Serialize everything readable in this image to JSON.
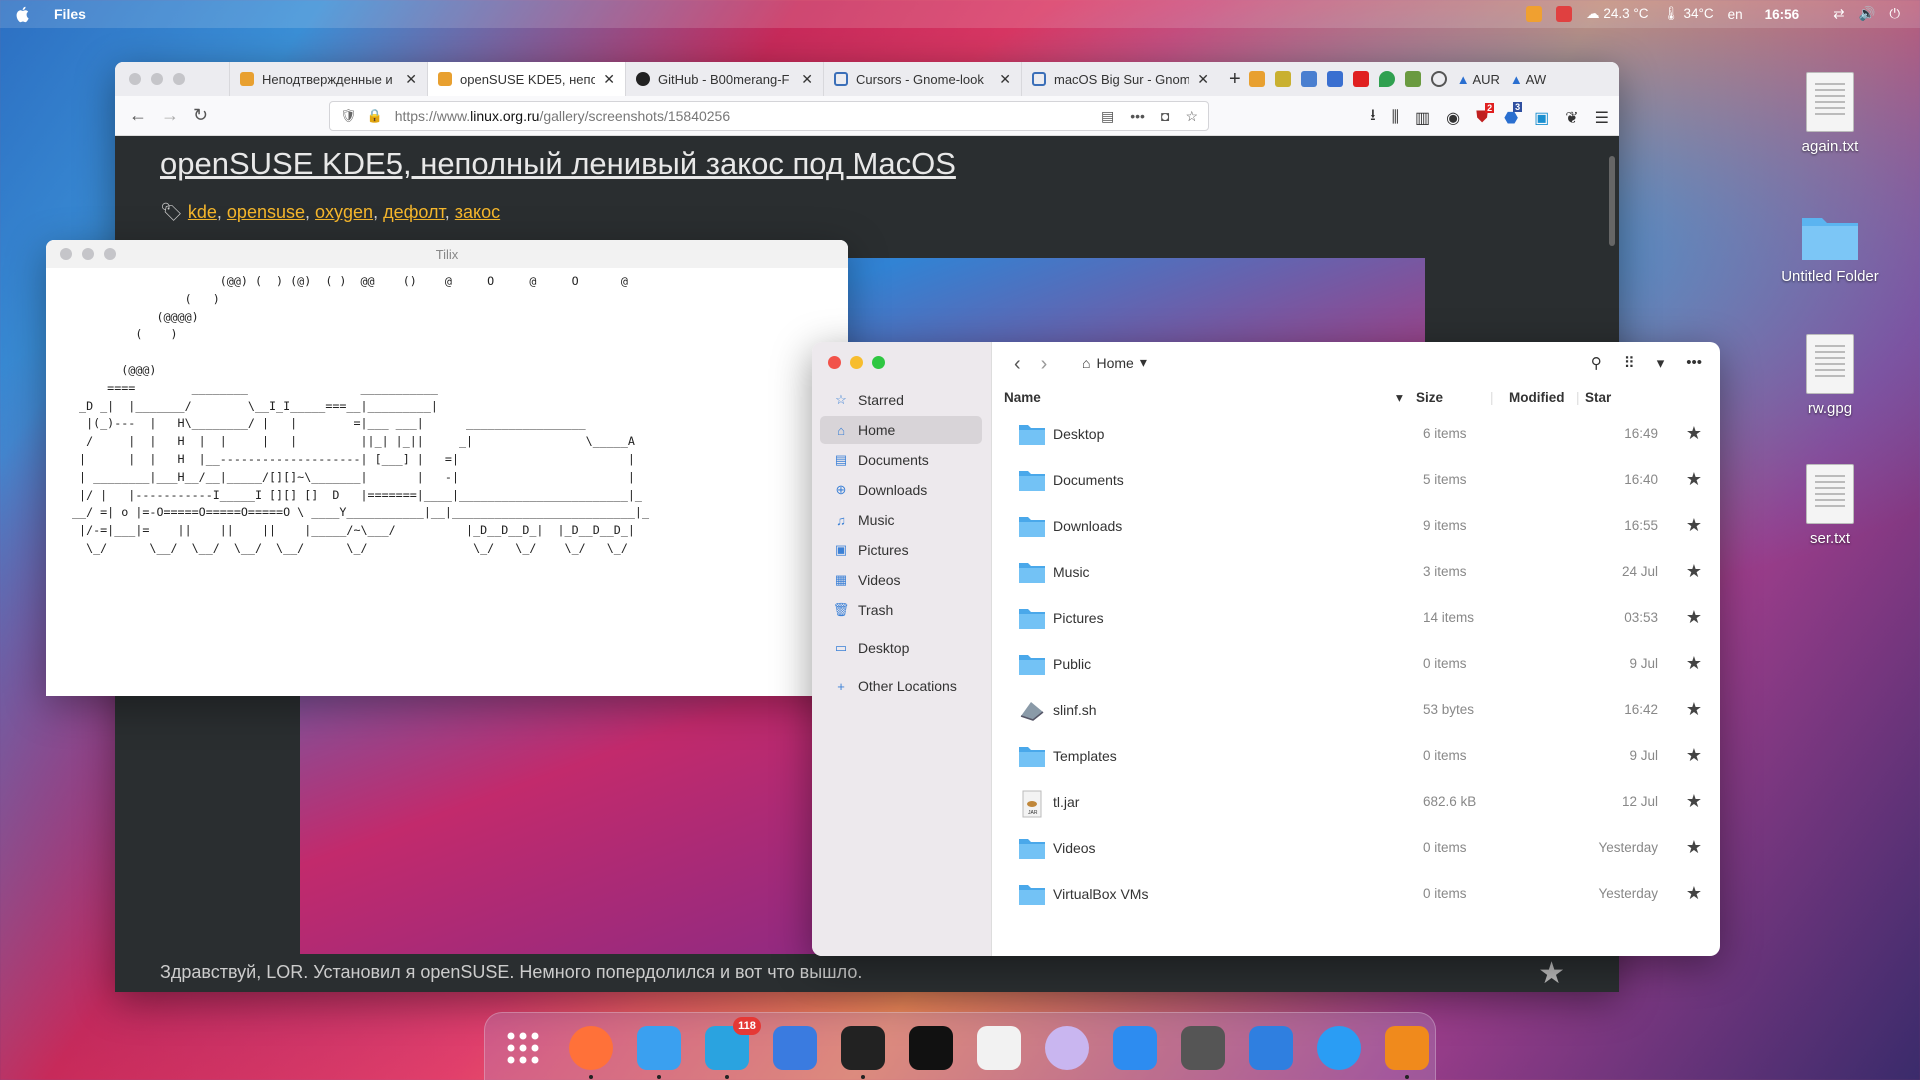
{
  "topbar": {
    "app_name": "Files",
    "weather1": "24.3 °C",
    "weather2": "34°C",
    "lang": "en",
    "time": "16:56",
    "notif_badge": "118"
  },
  "browser": {
    "tabs": [
      {
        "label": "Неподтвержденные и",
        "icon_color": "#e8a030"
      },
      {
        "label": "openSUSE KDE5, непол",
        "icon_color": "#e8a030",
        "active": true
      },
      {
        "label": "GitHub - B00merang-F",
        "icon_color": "#222222"
      },
      {
        "label": "Cursors - Gnome-look",
        "icon_color": "#3b6fb8"
      },
      {
        "label": "macOS Big Sur - Gnom",
        "icon_color": "#3b6fb8"
      }
    ],
    "ext_aur": "AUR",
    "ext_aw": "AW",
    "ext_badge1": "2",
    "ext_badge2": "3",
    "url_prefix": "https://www.",
    "url_domain": "linux.org.ru",
    "url_path": "/gallery/screenshots/15840256",
    "page_title": "openSUSE KDE5, неполный ленивый закос под MacOS",
    "tags": [
      "kde",
      "opensuse",
      "oxygen",
      "дефолт",
      "закос"
    ],
    "intro_text": "Здравствуй, LOR. Установил я openSUSE. Немного попердолился и вот что вышло."
  },
  "tilix": {
    "title": "Tilix",
    "ascii": "                     (@@) (  ) (@)  ( )  @@    ()    @     O     @     O      @\n                (   )\n            (@@@@)\n         (    )\n\n       (@@@)\n     ====        ________                ___________\n _D _|  |_______/        \\__I_I_____===__|_________|\n  |(_)---  |   H\\________/ |   |        =|___ ___|      _________________\n  /     |  |   H  |  |     |   |         ||_| |_||     _|                \\_____A\n |      |  |   H  |__--------------------| [___] |   =|                        |\n | ________|___H__/__|_____/[][]~\\_______|       |   -|                        |\n |/ |   |-----------I_____I [][] []  D   |=======|____|________________________|_\n__/ =| o |=-O=====O=====O=====O \\ ____Y___________|__|__________________________|_\n |/-=|___|=    ||    ||    ||    |_____/~\\___/          |_D__D__D_|  |_D__D__D_|\n  \\_/      \\__/  \\__/  \\__/  \\__/      \\_/               \\_/   \\_/    \\_/   \\_/"
  },
  "files": {
    "location": "Home",
    "sidebar": [
      {
        "label": "Starred",
        "icon": "star-icon"
      },
      {
        "label": "Home",
        "icon": "home-icon",
        "selected": true
      },
      {
        "label": "Documents",
        "icon": "documents-icon"
      },
      {
        "label": "Downloads",
        "icon": "downloads-icon"
      },
      {
        "label": "Music",
        "icon": "music-icon"
      },
      {
        "label": "Pictures",
        "icon": "pictures-icon"
      },
      {
        "label": "Videos",
        "icon": "videos-icon"
      },
      {
        "label": "Trash",
        "icon": "trash-icon"
      },
      {
        "label": "Desktop",
        "icon": "desktop-icon"
      },
      {
        "label": "Other Locations",
        "icon": "plus-icon"
      }
    ],
    "columns": {
      "name": "Name",
      "size": "Size",
      "modified": "Modified",
      "star": "Star"
    },
    "rows": [
      {
        "name": "Desktop",
        "size": "6 items",
        "modified": "16:49",
        "type": "folder"
      },
      {
        "name": "Documents",
        "size": "5 items",
        "modified": "16:40",
        "type": "folder"
      },
      {
        "name": "Downloads",
        "size": "9 items",
        "modified": "16:55",
        "type": "folder"
      },
      {
        "name": "Music",
        "size": "3 items",
        "modified": "24 Jul",
        "type": "folder"
      },
      {
        "name": "Pictures",
        "size": "14 items",
        "modified": "03:53",
        "type": "folder"
      },
      {
        "name": "Public",
        "size": "0 items",
        "modified": "9 Jul",
        "type": "folder"
      },
      {
        "name": "slinf.sh",
        "size": "53 bytes",
        "modified": "16:42",
        "type": "script"
      },
      {
        "name": "Templates",
        "size": "0 items",
        "modified": "9 Jul",
        "type": "folder"
      },
      {
        "name": "tl.jar",
        "size": "682.6 kB",
        "modified": "12 Jul",
        "type": "jar"
      },
      {
        "name": "Videos",
        "size": "0 items",
        "modified": "Yesterday",
        "type": "folder"
      },
      {
        "name": "VirtualBox VMs",
        "size": "0 items",
        "modified": "Yesterday",
        "type": "folder"
      }
    ]
  },
  "desktop": {
    "icons": [
      {
        "label": "again.txt",
        "type": "doc"
      },
      {
        "label": "Untitled Folder",
        "type": "folder"
      },
      {
        "label": "rw.gpg",
        "type": "doc"
      },
      {
        "label": "ser.txt",
        "type": "doc"
      }
    ]
  },
  "dock": {
    "apps": [
      {
        "name": "app-grid",
        "color": "#2a2a4a"
      },
      {
        "name": "firefox",
        "color": "#ff7139",
        "running": true
      },
      {
        "name": "finder",
        "color": "#3aa0f0",
        "running": true
      },
      {
        "name": "telegram",
        "color": "#2aa3e0",
        "running": true,
        "badge": "118"
      },
      {
        "name": "app-store",
        "color": "#3a7be0"
      },
      {
        "name": "tilix",
        "color": "#222222",
        "running": true
      },
      {
        "name": "terminal",
        "color": "#111111"
      },
      {
        "name": "text-editor",
        "color": "#f2f2f2"
      },
      {
        "name": "privacy",
        "color": "#c9b6f0"
      },
      {
        "name": "mail",
        "color": "#2d8cf0"
      },
      {
        "name": "vim",
        "color": "#555555"
      },
      {
        "name": "settings",
        "color": "#2f7fe0"
      },
      {
        "name": "safari",
        "color": "#2a9df4"
      },
      {
        "name": "vlc",
        "color": "#f08a1c",
        "running": true
      }
    ]
  }
}
